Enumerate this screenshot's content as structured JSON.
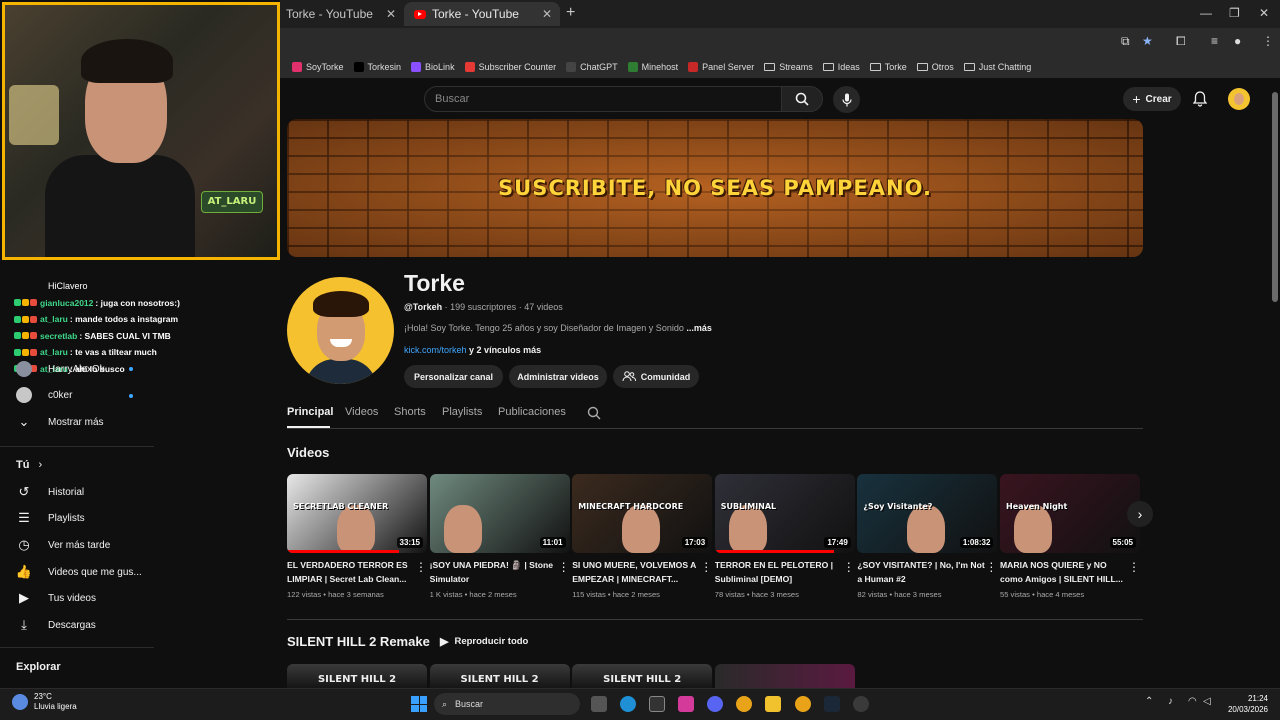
{
  "browser": {
    "tabs": [
      {
        "title": "Torke - YouTube",
        "active": false
      },
      {
        "title": "Torke - YouTube",
        "active": true
      }
    ],
    "bookmarks": [
      {
        "label": "SoyTorke",
        "icon": "instagram-icon",
        "color": "#e1306c"
      },
      {
        "label": "Torkesin",
        "icon": "x-icon",
        "color": "#000000"
      },
      {
        "label": "BioLink",
        "icon": "biolink-icon",
        "color": "#8a4fff"
      },
      {
        "label": "Subscriber Counter",
        "icon": "counter-icon",
        "color": "#e53935"
      },
      {
        "label": "ChatGPT",
        "icon": "chatgpt-icon",
        "color": "#444444"
      },
      {
        "label": "Minehost",
        "icon": "minehost-icon",
        "color": "#2e7d32"
      },
      {
        "label": "Panel Server",
        "icon": "server-icon",
        "color": "#c62828"
      },
      {
        "label": "Streams",
        "icon": "folder-icon",
        "color": ""
      },
      {
        "label": "Ideas",
        "icon": "folder-icon",
        "color": ""
      },
      {
        "label": "Torke",
        "icon": "folder-icon",
        "color": ""
      },
      {
        "label": "Otros",
        "icon": "folder-icon",
        "color": ""
      },
      {
        "label": "Just Chatting",
        "icon": "folder-icon",
        "color": ""
      }
    ]
  },
  "webcam": {
    "badge": "AT_LARU"
  },
  "chat": [
    {
      "user": "",
      "message": "HiClavero",
      "plain": true
    },
    {
      "user": "gianluca2012",
      "message": ": juga con nosotros:)"
    },
    {
      "user": "at_laru",
      "message": ": mande todos a instagram"
    },
    {
      "user": "secretlab",
      "message": ": SABES CUAL VI TMB"
    },
    {
      "user": "at_laru",
      "message": ": te vas a tiltear much"
    },
    {
      "user": "at_laru",
      "message": ": ahi lo busco"
    }
  ],
  "sidebar": {
    "subscriptions": [
      {
        "label": "HarryAlexOk",
        "live": true
      },
      {
        "label": "c0ker",
        "live": true
      }
    ],
    "show_more": "Mostrar más",
    "you_heading": "Tú",
    "you_items": [
      {
        "label": "Historial",
        "icon": "history-icon"
      },
      {
        "label": "Playlists",
        "icon": "playlists-icon"
      },
      {
        "label": "Ver más tarde",
        "icon": "watch-later-icon"
      },
      {
        "label": "Videos que me gus...",
        "icon": "like-icon"
      },
      {
        "label": "Tus videos",
        "icon": "your-videos-icon"
      },
      {
        "label": "Descargas",
        "icon": "download-icon"
      }
    ],
    "explore_heading": "Explorar"
  },
  "header": {
    "search_placeholder": "Buscar",
    "create_label": "Crear"
  },
  "banner": {
    "text": "SUSCRIBITE, NO SEAS PAMPEANO."
  },
  "channel": {
    "name": "Torke",
    "handle": "@Torkeh",
    "subscribers": "199 suscriptores",
    "videos_count": "47 videos",
    "description": "¡Hola! Soy Torke. Tengo 25 años y soy Diseñador de Imagen y Sonido",
    "more": "...más",
    "link": "kick.com/torkeh",
    "more_links": "y 2 vínculos más",
    "buttons": [
      "Personalizar canal",
      "Administrar videos",
      "Comunidad"
    ]
  },
  "tabs": [
    "Principal",
    "Videos",
    "Shorts",
    "Playlists",
    "Publicaciones"
  ],
  "videos_section": {
    "title": "Videos",
    "items": [
      {
        "title": "EL VERDADERO TERROR ES LIMPIAR | Secret Lab Clean...",
        "meta": "122 vistas • hace 3 semanas",
        "duration": "33:15",
        "thumb_text": "SECRETLAB CLEANER",
        "bg": "#e8e8e8",
        "progress": 0.8
      },
      {
        "title": "¡SOY UNA PIEDRA! 🗿 | Stone Simulator",
        "meta": "1 K vistas • hace 2 meses",
        "duration": "11:01",
        "thumb_text": "",
        "bg": "#6f8a7f",
        "progress": 0
      },
      {
        "title": "SI UNO MUERE, VOLVEMOS A EMPEZAR | MINECRAFT...",
        "meta": "115 vistas • hace 2 meses",
        "duration": "17:03",
        "thumb_text": "MINECRAFT HARDCORE",
        "bg": "#3b2a1e",
        "progress": 0
      },
      {
        "title": "TERROR EN EL PELOTERO | Subliminal [DEMO]",
        "meta": "78 vistas • hace 3 meses",
        "duration": "17:49",
        "thumb_text": "SUBLIMINAL",
        "bg": "#2f2f38",
        "progress": 0.85
      },
      {
        "title": "¿SOY VISITANTE? | No, I'm Not a Human #2",
        "meta": "82 vistas • hace 3 meses",
        "duration": "1:08:32",
        "thumb_text": "¿Soy Visitante?",
        "bg": "#18323e",
        "progress": 0
      },
      {
        "title": "MARIA NOS QUIERE y NO como Amigos | SILENT HILL...",
        "meta": "55 vistas • hace 4 meses",
        "duration": "55:05",
        "thumb_text": "Heaven Night",
        "bg": "#3a1420",
        "progress": 0
      }
    ]
  },
  "playlist_section": {
    "title": "SILENT HILL 2 Remake",
    "play_all": "Reproducir todo",
    "thumb_text": "SILENT HILL 2"
  },
  "taskbar": {
    "weather_temp": "23°C",
    "weather_desc": "Lluvia ligera",
    "search_label": "Buscar",
    "time": "21:24",
    "date": "20/03/2026"
  }
}
